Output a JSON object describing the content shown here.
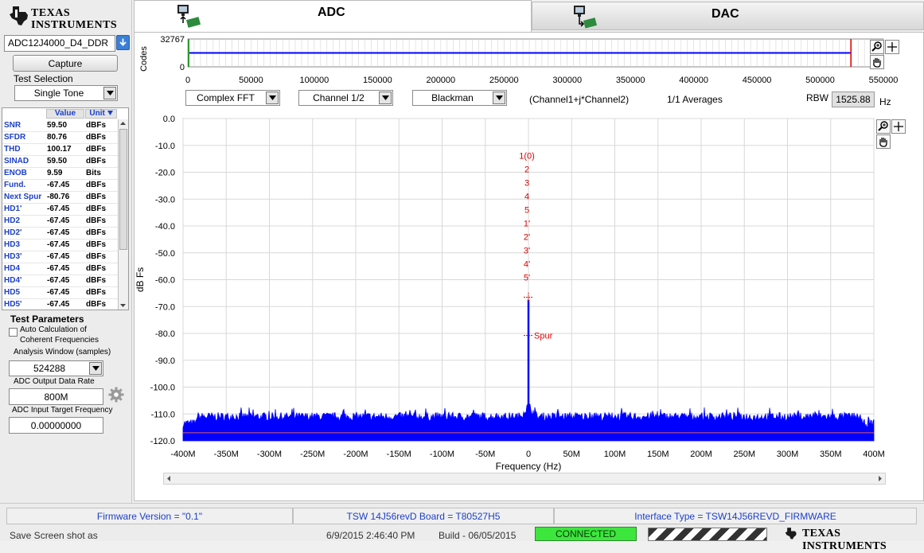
{
  "logo": {
    "line1": "TEXAS",
    "line2": "INSTRUMENTS"
  },
  "device_select": {
    "value": "ADC12J4000_D4_DDR"
  },
  "capture_label": "Capture",
  "test_selection": {
    "label": "Test Selection",
    "value": "Single Tone"
  },
  "metrics": {
    "headers": {
      "value": "Value",
      "unit": "Unit"
    },
    "rows": [
      {
        "name": "SNR",
        "value": "59.50",
        "unit": "dBFs"
      },
      {
        "name": "SFDR",
        "value": "80.76",
        "unit": "dBFs"
      },
      {
        "name": "THD",
        "value": "100.17",
        "unit": "dBFs"
      },
      {
        "name": "SINAD",
        "value": "59.50",
        "unit": "dBFs"
      },
      {
        "name": "ENOB",
        "value": "9.59",
        "unit": "Bits"
      },
      {
        "name": "Fund.",
        "value": "-67.45",
        "unit": "dBFs"
      },
      {
        "name": "Next Spur",
        "value": "-80.76",
        "unit": "dBFs"
      },
      {
        "name": "HD1'",
        "value": "-67.45",
        "unit": "dBFs"
      },
      {
        "name": "HD2",
        "value": "-67.45",
        "unit": "dBFs"
      },
      {
        "name": "HD2'",
        "value": "-67.45",
        "unit": "dBFs"
      },
      {
        "name": "HD3",
        "value": "-67.45",
        "unit": "dBFs"
      },
      {
        "name": "HD3'",
        "value": "-67.45",
        "unit": "dBFs"
      },
      {
        "name": "HD4",
        "value": "-67.45",
        "unit": "dBFs"
      },
      {
        "name": "HD4'",
        "value": "-67.45",
        "unit": "dBFs"
      },
      {
        "name": "HD5",
        "value": "-67.45",
        "unit": "dBFs"
      },
      {
        "name": "HD5'",
        "value": "-67.45",
        "unit": "dBFs"
      }
    ]
  },
  "test_parameters": {
    "title": "Test Parameters",
    "auto_calc_line1": "Auto Calculation of",
    "auto_calc_line2": "Coherent Frequencies",
    "auto_calc_checked": false,
    "analysis_window_label": "Analysis Window (samples)",
    "analysis_window_value": "524288",
    "output_rate_label": "ADC Output Data Rate",
    "output_rate_value": "800M",
    "input_freq_label": "ADC Input Target Frequency",
    "input_freq_value": "0.00000000"
  },
  "tabs": {
    "adc": "ADC",
    "dac": "DAC",
    "active": "ADC"
  },
  "controls": {
    "fft_mode": "Complex FFT",
    "channel": "Channel 1/2",
    "window": "Blackman",
    "expression": "(Channel1+j*Channel2)",
    "averages": "1/1 Averages",
    "rbw_label": "RBW",
    "rbw_value": "1525.88",
    "rbw_unit": "Hz"
  },
  "status": {
    "firmware": "Firmware Version = \"0.1\"",
    "board": "TSW 14J56revD Board = T80527H5",
    "interface": "Interface Type = TSW14J56REVD_FIRMWARE",
    "save_label": "Save Screen shot as",
    "timestamp": "6/9/2015 2:46:40 PM",
    "build": "Build  - 06/05/2015",
    "connection": "CONNECTED",
    "bottom_logo": "TEXAS INSTRUMENTS"
  },
  "colors": {
    "trace": "#0000ff",
    "marker": "#e00000",
    "connected": "#3de63d",
    "header_text": "#1c3fc7"
  },
  "chart_data": [
    {
      "type": "line",
      "name": "codes-overview",
      "ylabel": "Codes",
      "xlim": [
        0,
        550000
      ],
      "ylim": [
        0,
        32767
      ],
      "x_ticks": [
        "0",
        "50000",
        "100000",
        "150000",
        "200000",
        "250000",
        "300000",
        "350000",
        "400000",
        "450000",
        "500000",
        "550000"
      ],
      "y_ticks": [
        "32767",
        "0"
      ],
      "series": [
        {
          "x": [
            0,
            524288
          ],
          "y": [
            16384,
            16384
          ]
        }
      ],
      "cursor_x": 524288
    },
    {
      "type": "line",
      "name": "fft-spectrum",
      "xlabel": "Frequency (Hz)",
      "ylabel": "dB Fs",
      "xlim": [
        -400,
        400
      ],
      "x_unit": "MHz",
      "ylim": [
        -120,
        0
      ],
      "grid": true,
      "x_ticks": [
        "-400M",
        "-350M",
        "-300M",
        "-250M",
        "-200M",
        "-150M",
        "-100M",
        "-50M",
        "0",
        "50M",
        "100M",
        "150M",
        "200M",
        "250M",
        "300M",
        "350M",
        "400M"
      ],
      "y_ticks": [
        "0.0",
        "-10.0",
        "-20.0",
        "-30.0",
        "-40.0",
        "-50.0",
        "-60.0",
        "-70.0",
        "-80.0",
        "-90.0",
        "-100.0",
        "-110.0",
        "-120.0"
      ],
      "noise_floor_db": -111,
      "peak": {
        "x": 0,
        "y": -67.45
      },
      "harmonic_labels": [
        "1(0)",
        "2",
        "3",
        "4",
        "5",
        "1'",
        "2'",
        "3'",
        "4'",
        "5'"
      ],
      "spur_label": "Spur",
      "spur": {
        "x": 0,
        "y": -80.76
      }
    }
  ]
}
